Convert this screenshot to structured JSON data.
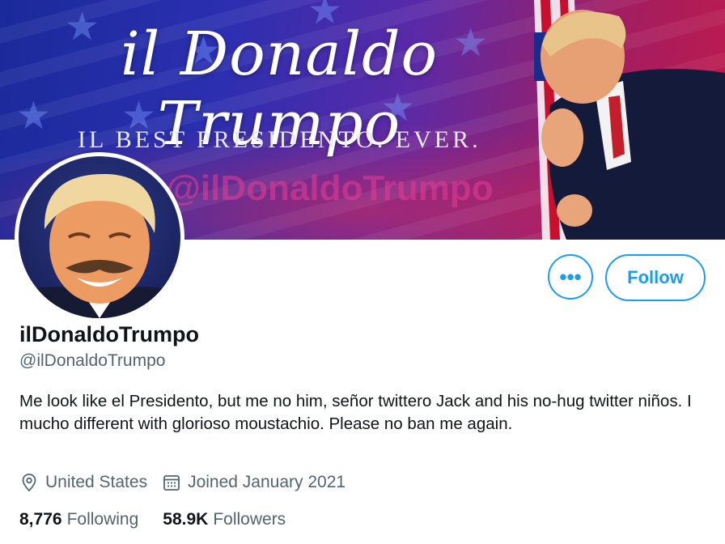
{
  "banner": {
    "script_title": "il Donaldo Trumpo",
    "subtitle": "Il Best Presidento. Ever.",
    "handle_overlay": "@ilDonaldoTrumpo"
  },
  "profile": {
    "display_name": "ilDonaldoTrumpo",
    "handle": "@ilDonaldoTrumpo",
    "bio": "Me look like el Presidento, but me no him, señor twittero Jack and his no-hug twitter niños. I mucho different with glorioso moustachio. Please no ban me again.",
    "location": "United States",
    "joined": "Joined January 2021"
  },
  "actions": {
    "more_label": "•••",
    "follow_label": "Follow"
  },
  "stats": {
    "following_count": "8,776",
    "following_label": "Following",
    "followers_count": "58.9K",
    "followers_label": "Followers"
  },
  "colors": {
    "accent": "#1d9bf0",
    "secondary_text": "#536471",
    "primary_text": "#0f1419"
  }
}
